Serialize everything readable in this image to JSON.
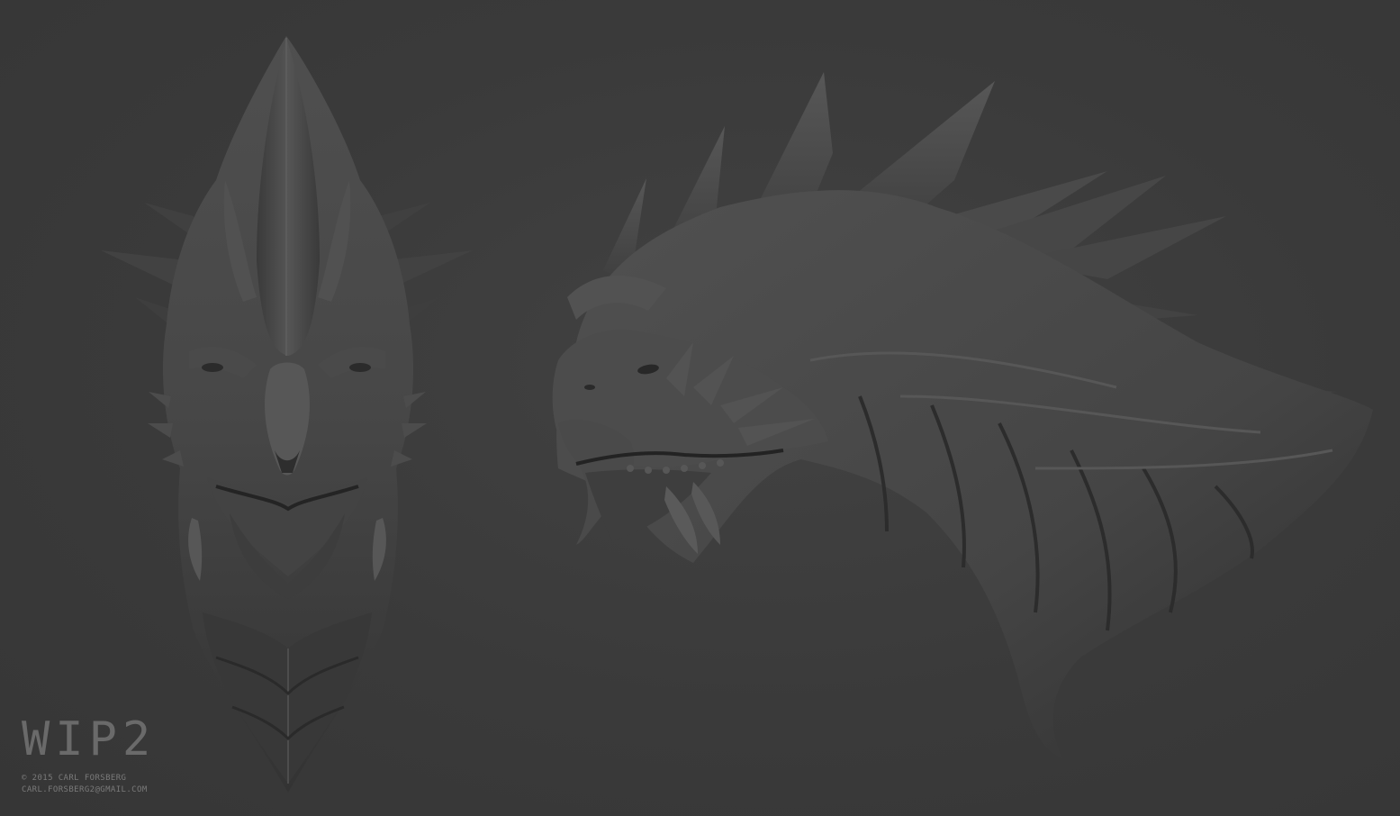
{
  "caption": {
    "title": "WIP2",
    "copyright": "© 2015 CARL FORSBERG",
    "email": "CARL.FORSBERG2@GMAIL.COM"
  },
  "colors": {
    "background": "#3b3b3b",
    "sculpt_base": "#4a4a4a",
    "sculpt_shadow": "#262626",
    "sculpt_highlight": "#666666",
    "caption_text": "#6a6a6a"
  },
  "views": [
    {
      "name": "front-view",
      "subject": "dragon head sculpt, front view"
    },
    {
      "name": "side-view",
      "subject": "dragon head and neck sculpt, three-quarter side view"
    }
  ]
}
